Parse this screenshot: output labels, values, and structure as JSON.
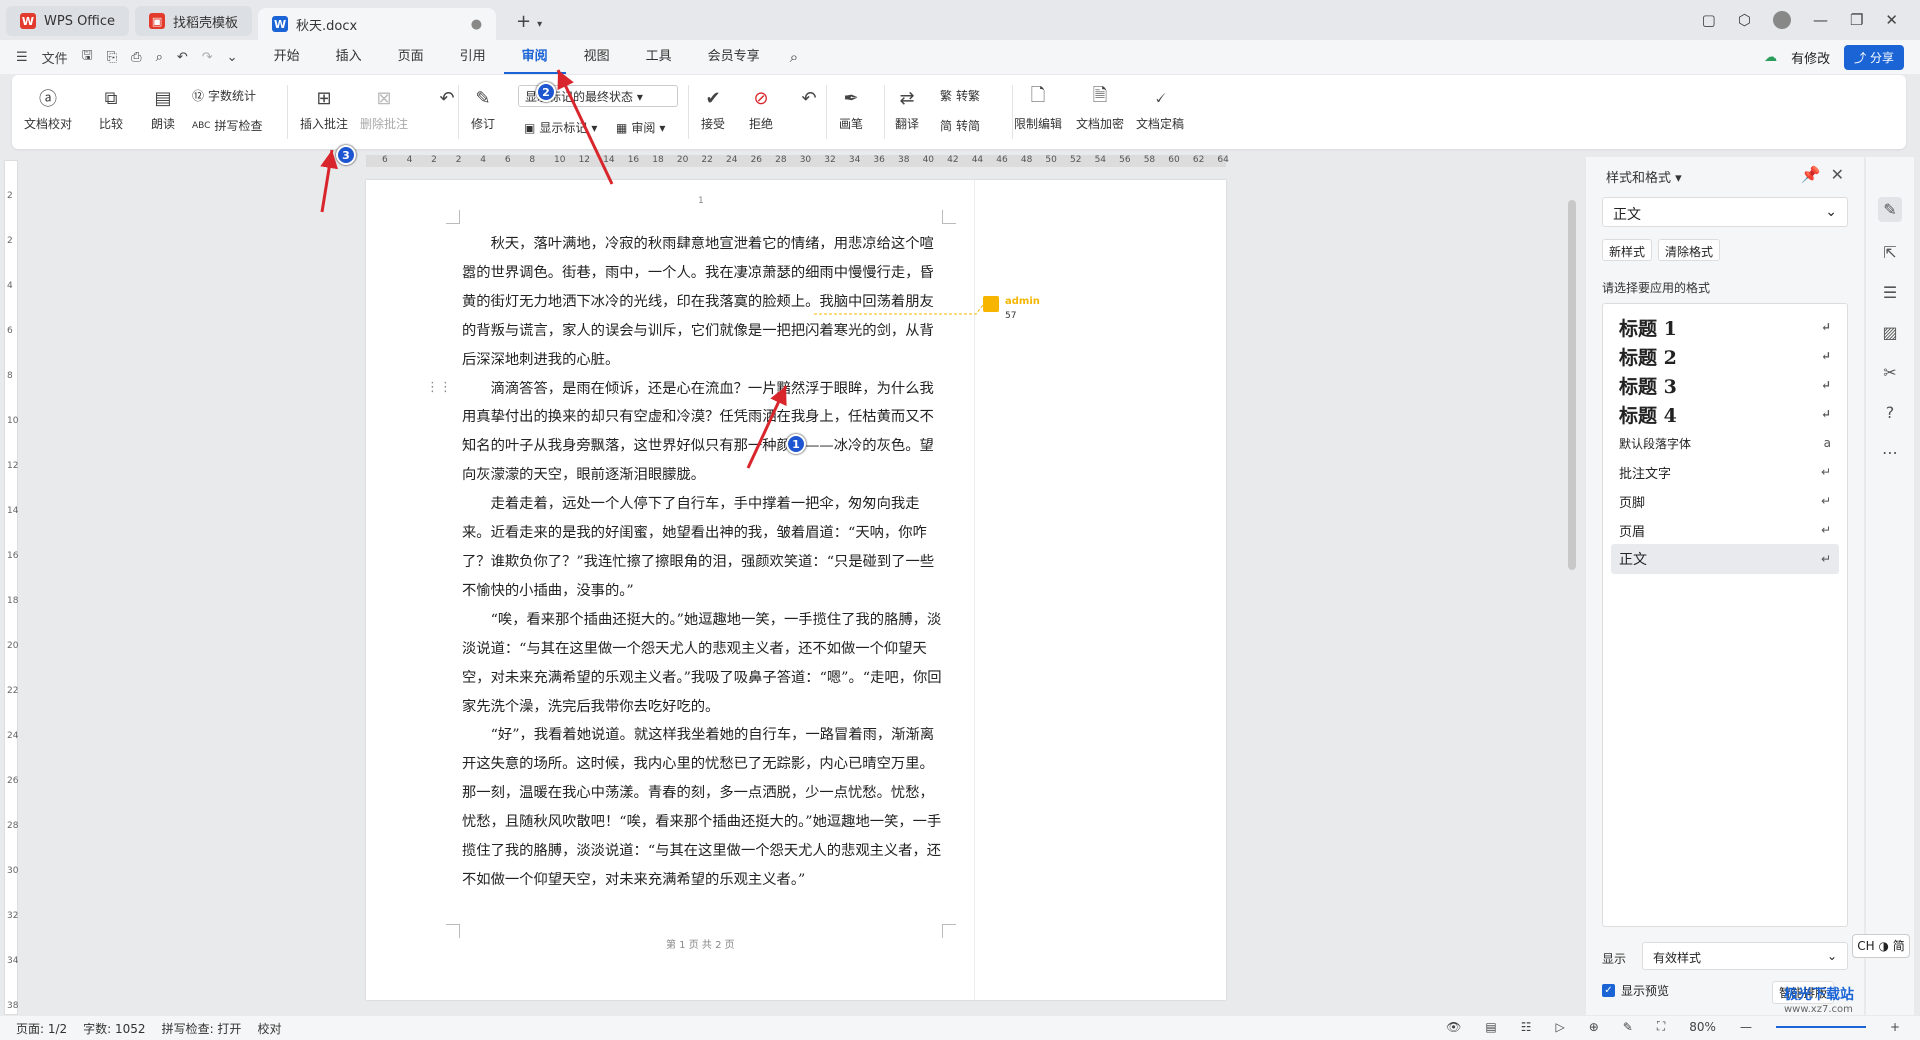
{
  "titlebar": {
    "tabs": [
      {
        "label": "WPS Office",
        "logo_color": "#e23b2e"
      },
      {
        "label": "找稻壳模板",
        "logo_color": "#e23b2e"
      },
      {
        "label": "秋天.docx",
        "logo_color": "#1a64d6"
      }
    ],
    "new_tab": "+"
  },
  "menubar": {
    "file_label": "文件",
    "tabs": [
      "开始",
      "插入",
      "页面",
      "引用",
      "审阅",
      "视图",
      "工具",
      "会员专享"
    ],
    "active_tab": "审阅",
    "modified_label": "有修改",
    "share_label": "分享"
  },
  "ribbon": {
    "doc_proof": "文档校对",
    "compare": "比较",
    "read_aloud": "朗读",
    "word_count": "字数统计",
    "spell_check": "拼写检查",
    "insert_comment": "插入批注",
    "delete_comment": "删除批注",
    "track_changes": "修订",
    "display_state": "显示标记的最终状态",
    "show_markup": "显示标记",
    "review_pane": "审阅",
    "accept": "接受",
    "reject": "拒绝",
    "ink": "画笔",
    "translate": "翻译",
    "to_traditional": "转繁",
    "to_simplified": "转简",
    "restrict_edit": "限制编辑",
    "encrypt": "文档加密",
    "finalize": "文档定稿"
  },
  "ruler_numbers": [
    "6",
    "4",
    "2",
    "2",
    "4",
    "6",
    "8",
    "10",
    "12",
    "14",
    "16",
    "18",
    "20",
    "22",
    "24",
    "26",
    "28",
    "30",
    "32",
    "34",
    "36",
    "38",
    "40",
    "42",
    "44",
    "46",
    "48",
    "50",
    "52",
    "54",
    "56",
    "58",
    "60",
    "62",
    "64"
  ],
  "vruler_numbers": [
    "2",
    "2",
    "4",
    "6",
    "8",
    "10",
    "12",
    "14",
    "16",
    "18",
    "20",
    "22",
    "24",
    "26",
    "28",
    "30",
    "32",
    "34",
    "38"
  ],
  "document": {
    "page_top_number": "1",
    "paragraphs": [
      "秋天，落叶满地，冷寂的秋雨肆意地宣泄着它的情绪，用悲凉给这个喧嚣的世界调色。街巷，雨中，一个人。我在凄凉萧瑟的细雨中慢慢行走，昏黄的街灯无力地洒下冰冷的光线，印在我落寞的脸颊上。我脑中回荡着朋友的背叛与谎言，家人的误会与训斥，它们就像是一把把闪着寒光的剑，从背后深深地刺进我的心脏。",
      "滴滴答答，是雨在倾诉，还是心在流血？一片黯然浮于眼眸，为什么我用真挚付出的换来的却只有空虚和冷漠？任凭雨洒在我身上，任枯黄而又不知名的叶子从我身旁飘落，这世界好似只有那一种颜色——冰冷的灰色。望向灰濛濛的天空，眼前逐渐泪眼朦胧。",
      "走着走着，远处一个人停下了自行车，手中撑着一把伞，匆匆向我走来。近看走来的是我的好闺蜜，她望看出神的我，皱着眉道：“天呐，你咋了？谁欺负你了？”我连忙擦了擦眼角的泪，强颜欢笑道：“只是碰到了一些不愉快的小插曲，没事的。”",
      "“唉，看来那个插曲还挺大的。”她逗趣地一笑，一手揽住了我的胳膊，淡淡说道：“与其在这里做一个怨天尤人的悲观主义者，还不如做一个仰望天空，对未来充满希望的乐观主义者。”我吸了吸鼻子答道：“嗯”。“走吧，你回家先洗个澡，洗完后我带你去吃好吃的。",
      "“好”，我看着她说道。就这样我坐着她的自行车，一路冒着雨，渐渐离开这失意的场所。这时候，我内心里的忧愁已了无踪影，内心已晴空万里。那一刻，温暖在我心中荡漾。青春的刻，多一点洒脱，少一点忧愁。忧愁，忧愁，且随秋风吹散吧！“唉，看来那个插曲还挺大的。”她逗趣地一笑，一手揽住了我的胳膊，淡淡说道：“与其在这里做一个怨天尤人的悲观主义者，还不如做一个仰望天空，对未来充满希望的乐观主义者。”"
    ],
    "footer": "第 1 页 共 2 页",
    "comment": {
      "author": "admin",
      "text": "57"
    }
  },
  "side_panel": {
    "title": "样式和格式",
    "current_style": "正文",
    "new_style": "新样式",
    "clear_format": "清除格式",
    "choose_label": "请选择要应用的格式",
    "styles": [
      {
        "label": "标题  1",
        "heading": true
      },
      {
        "label": "标题  2",
        "heading": true
      },
      {
        "label": "标题  3",
        "heading": true
      },
      {
        "label": "标题  4",
        "heading": true
      },
      {
        "label": "默认段落字体",
        "heading": false,
        "mark": "a"
      },
      {
        "label": "批注文字",
        "heading": false
      },
      {
        "label": "页脚",
        "heading": false
      },
      {
        "label": "页眉",
        "heading": false
      },
      {
        "label": "正文",
        "heading": false,
        "selected": true
      }
    ],
    "show_label": "显示",
    "show_value": "有效样式",
    "preview_label": "显示预览",
    "smart_layout": "智能排版"
  },
  "ime": "CH ◑ 简",
  "statusbar": {
    "page": "页面: 1/2",
    "words": "字数: 1052",
    "spell": "拼写检查: 打开",
    "proof": "校对",
    "zoom": "80%"
  },
  "annotations": [
    "1",
    "2",
    "3"
  ],
  "watermark": {
    "title": "极光下载站",
    "url": "www.xz7.com"
  },
  "colors": {
    "accent": "#1a64d6",
    "marker": "#1d56d0",
    "arrow": "#d8262c",
    "comment": "#f7b500"
  }
}
